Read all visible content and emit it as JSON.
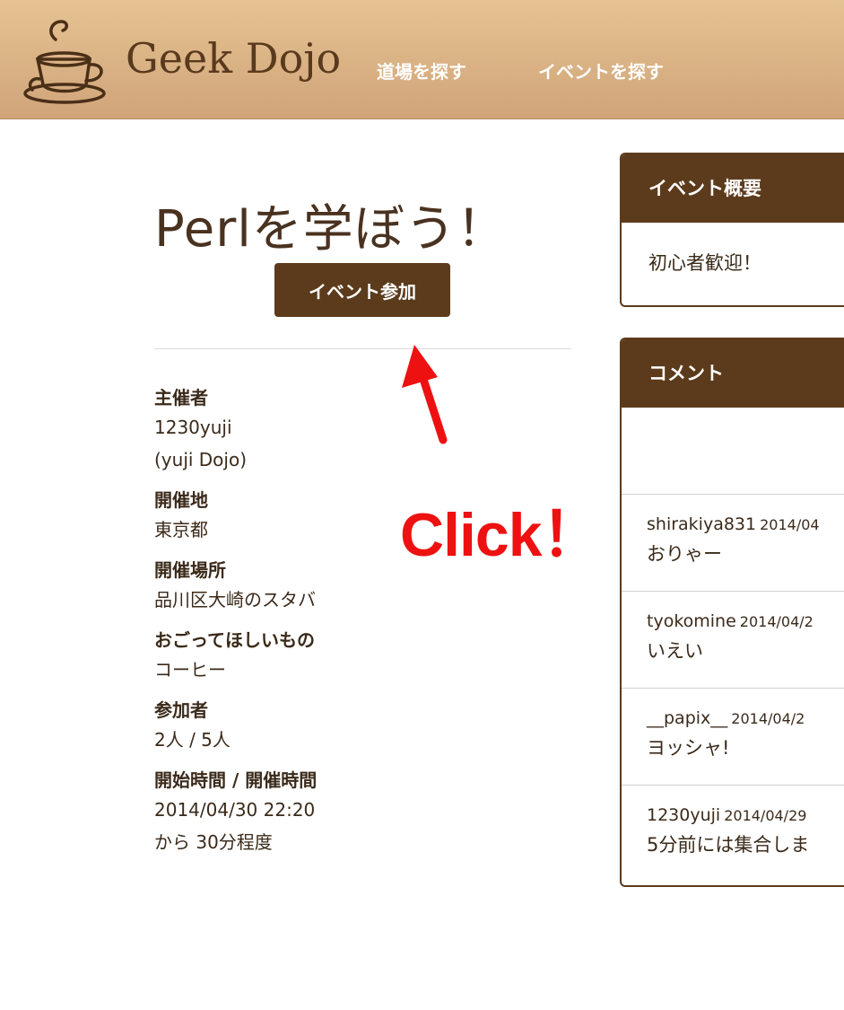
{
  "header": {
    "brand": "Geek Dojo",
    "nav": [
      "道場を探す",
      "イベントを探す"
    ]
  },
  "event": {
    "title": "Perlを学ぼう！",
    "join_label": "イベント参加"
  },
  "info": [
    {
      "label": "主催者",
      "value_lines": [
        "1230yuji",
        "(yuji Dojo)"
      ]
    },
    {
      "label": "開催地",
      "value_lines": [
        "東京都"
      ]
    },
    {
      "label": "開催場所",
      "value_lines": [
        "品川区大崎のスタバ"
      ]
    },
    {
      "label": "おごってほしいもの",
      "value_lines": [
        "コーヒー"
      ]
    },
    {
      "label": "参加者",
      "value_lines": [
        "2人 / 5人"
      ]
    },
    {
      "label": "開始時間 / 開催時間",
      "value_lines": [
        "2014/04/30 22:20",
        "から 30分程度"
      ]
    }
  ],
  "annotation": {
    "click_text": "Click！",
    "color": "#ee1111"
  },
  "summary_panel": {
    "title": "イベント概要",
    "body": "初心者歓迎！"
  },
  "comments_panel": {
    "title": "コメント",
    "comments": [
      {
        "user": "shirakiya831",
        "date": "2014/04",
        "text": "おりゃー"
      },
      {
        "user": "tyokomine",
        "date": "2014/04/2",
        "text": "いえい"
      },
      {
        "user": "__papix__",
        "date": "2014/04/2",
        "text": "ヨッシャ!"
      },
      {
        "user": "1230yuji",
        "date": "2014/04/29",
        "text": "5分前には集合しま"
      }
    ]
  },
  "colors": {
    "brand_brown": "#5c3b1c",
    "header_top": "#e6c392",
    "header_bottom": "#cfa479"
  }
}
